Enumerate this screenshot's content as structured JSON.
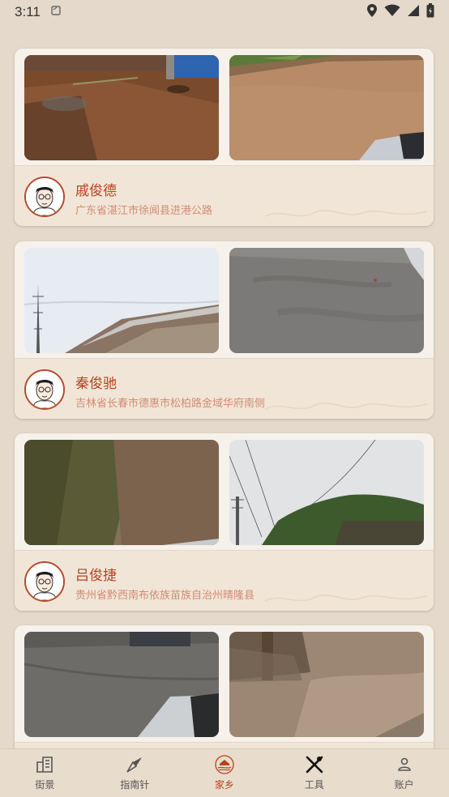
{
  "status": {
    "time": "3:11"
  },
  "feed": {
    "items": [
      {
        "name": "戚俊德",
        "address": "广东省湛江市徐闻县进港公路"
      },
      {
        "name": "秦俊驰",
        "address": "吉林省长春市德惠市松柏路金域华府南侧"
      },
      {
        "name": "吕俊捷",
        "address": "贵州省黔西南布依族苗族自治州晴隆县"
      },
      {
        "name": "",
        "address": ""
      }
    ]
  },
  "tabs": [
    {
      "label": "街景",
      "icon": "building-icon"
    },
    {
      "label": "指南针",
      "icon": "compass-icon"
    },
    {
      "label": "家乡",
      "icon": "hometown-icon",
      "active": true
    },
    {
      "label": "工具",
      "icon": "tools-icon"
    },
    {
      "label": "账户",
      "icon": "account-icon"
    }
  ],
  "colors": {
    "accent": "#b5431f",
    "background": "#e4d9cb",
    "card": "#f6f1ea",
    "info_bg": "#f1e5d7"
  }
}
